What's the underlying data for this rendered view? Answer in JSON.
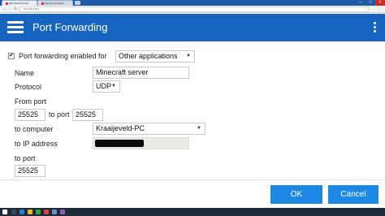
{
  "browser": {
    "tabs": [
      {
        "label": "NETGEAR Router"
      },
      {
        "label": "http://port.forward"
      }
    ],
    "address": "192.168.178.1"
  },
  "header": {
    "title": "Port Forwarding"
  },
  "form": {
    "enabled_label": "Port forwarding enabled for",
    "enabled_checked": true,
    "enabled_for_value": "Other applications",
    "name_label": "Name",
    "name_value": "Minecraft server",
    "protocol_label": "Protocol",
    "protocol_value": "UDP",
    "from_port_label": "From port",
    "from_port_value": "25525",
    "to_port_inline_label": "to port",
    "to_port_inline_value": "25525",
    "to_computer_label": "to computer",
    "to_computer_value": "Kraaijeveld-PC",
    "ip_label": "to IP address",
    "to_port_label": "to port",
    "to_port_value": "25525"
  },
  "buttons": {
    "ok": "OK",
    "cancel": "Cancel"
  },
  "colors": {
    "header": "#1565c0",
    "button": "#1e88e5"
  }
}
